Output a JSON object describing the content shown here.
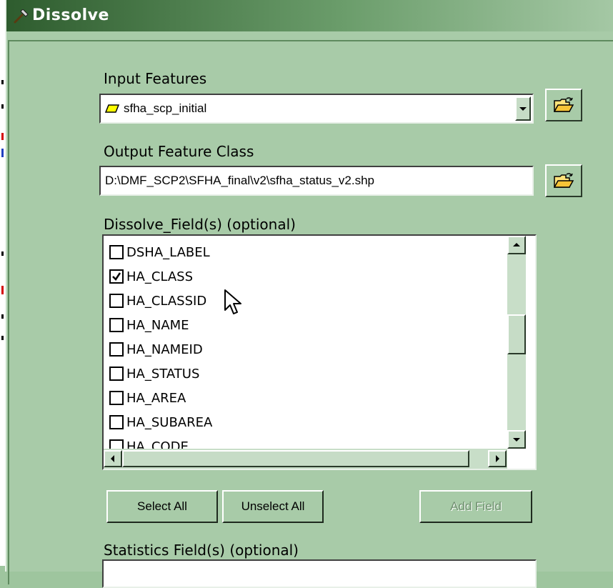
{
  "window": {
    "title": "Dissolve"
  },
  "input_features": {
    "label": "Input Features",
    "value": "sfha_scp_initial"
  },
  "output_feature_class": {
    "label": "Output Feature Class",
    "value": "D:\\DMF_SCP2\\SFHA_final\\v2\\sfha_status_v2.shp"
  },
  "dissolve_fields": {
    "label": "Dissolve_Field(s) (optional)",
    "items": [
      {
        "name": "DSHA_LABEL",
        "checked": false
      },
      {
        "name": "HA_CLASS",
        "checked": true
      },
      {
        "name": "HA_CLASSID",
        "checked": false
      },
      {
        "name": "HA_NAME",
        "checked": false
      },
      {
        "name": "HA_NAMEID",
        "checked": false
      },
      {
        "name": "HA_STATUS",
        "checked": false
      },
      {
        "name": "HA_AREA",
        "checked": false
      },
      {
        "name": "HA_SUBAREA",
        "checked": false
      },
      {
        "name": "HA_CODE",
        "checked": false
      }
    ]
  },
  "buttons": {
    "select_all": "Select All",
    "unselect_all": "Unselect All",
    "add_field": "Add Field"
  },
  "statistics_fields": {
    "label": "Statistics Field(s) (optional)"
  },
  "icons": {
    "title": "hammer-icon",
    "input_features_layer": "polygon-layer-icon",
    "browse": "open-folder-icon",
    "pointer": "mouse-cursor-icon"
  },
  "colors": {
    "dialog_background": "#a8cba8",
    "title_bar_start": "#2e5c2e",
    "field_background": "#ffffff",
    "polygon_symbol": "#ffff00"
  }
}
